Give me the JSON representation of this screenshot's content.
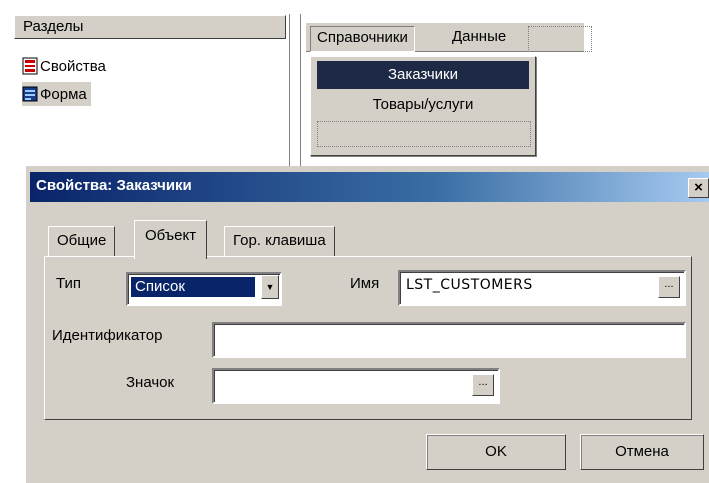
{
  "sections_panel": {
    "header": "Разделы",
    "items": [
      {
        "label": "Свойства",
        "icon": "properties-icon"
      },
      {
        "label": "Форма",
        "icon": "form-icon"
      }
    ]
  },
  "form_menu": {
    "items": [
      "Справочники",
      "Данные"
    ],
    "dropdown": [
      "Заказчики",
      "Товары/услуги"
    ]
  },
  "dialog": {
    "title": "Свойства: Заказчики",
    "close_label": "×",
    "tabs": [
      "Общие",
      "Объект",
      "Гор. клавиша"
    ],
    "active_tab": "Объект",
    "fields": {
      "type_label": "Тип",
      "type_value": "Список",
      "name_label": "Имя",
      "name_value": "LST_CUSTOMERS",
      "id_label": "Идентификатор",
      "id_value": "",
      "icon_label": "Значок",
      "icon_value": "",
      "ellipsis": "..."
    },
    "buttons": {
      "ok": "OK",
      "cancel": "Отмена"
    }
  },
  "colors": {
    "face": "#d4d0c8",
    "selection": "#0a246a",
    "title_start": "#0a246a",
    "title_end": "#a6caf0"
  }
}
